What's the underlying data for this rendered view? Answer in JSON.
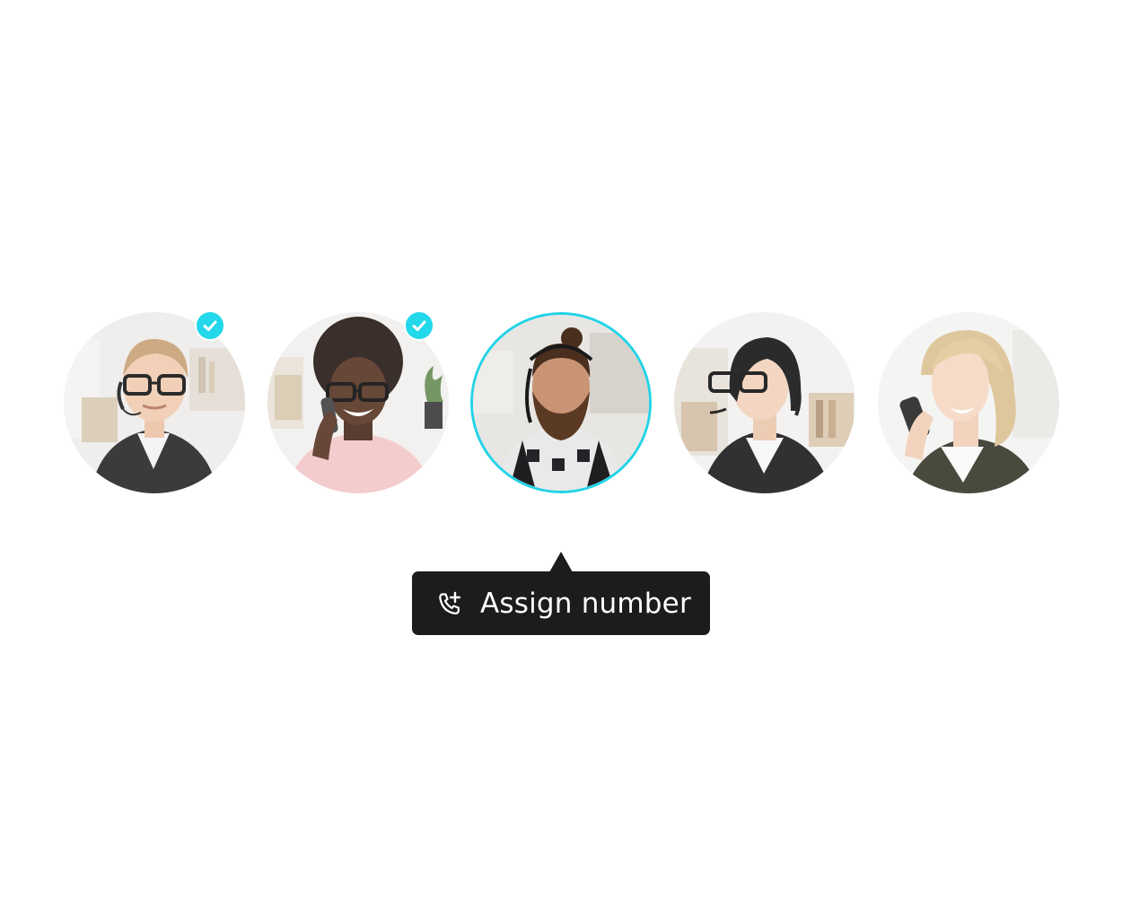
{
  "agents": [
    {
      "id": "agent-1",
      "selected_check": true,
      "highlighted": false
    },
    {
      "id": "agent-2",
      "selected_check": true,
      "highlighted": false
    },
    {
      "id": "agent-3",
      "selected_check": false,
      "highlighted": true
    },
    {
      "id": "agent-4",
      "selected_check": false,
      "highlighted": false
    },
    {
      "id": "agent-5",
      "selected_check": false,
      "highlighted": false
    }
  ],
  "tooltip": {
    "label": "Assign number",
    "icon": "phone-plus-icon"
  },
  "colors": {
    "accent": "#22d8ea",
    "highlight_ring": "#22d3e6",
    "tooltip_bg": "#1c1c1e",
    "tooltip_text": "#ffffff",
    "background": "#ffffff"
  }
}
